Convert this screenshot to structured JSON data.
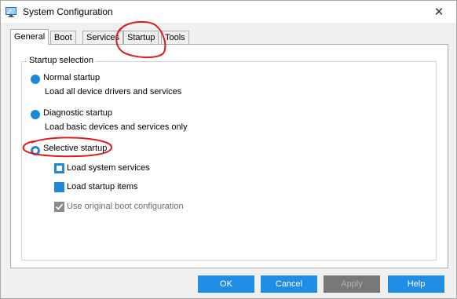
{
  "window": {
    "title": "System Configuration",
    "close_glyph": "✕"
  },
  "tabs": [
    {
      "label": "General",
      "active": true
    },
    {
      "label": "Boot",
      "active": false
    },
    {
      "label": "Services",
      "active": false
    },
    {
      "label": "Startup",
      "active": false
    },
    {
      "label": "Tools",
      "active": false
    }
  ],
  "startup_selection": {
    "legend": "Startup selection",
    "options": [
      {
        "label": "Normal startup",
        "description": "Load all device drivers and services",
        "selected": false
      },
      {
        "label": "Diagnostic startup",
        "description": "Load basic devices and services only",
        "selected": false
      },
      {
        "label": "Selective startup",
        "selected": true
      }
    ],
    "selective_items": [
      {
        "label": "Load system services",
        "checked": false,
        "enabled": true
      },
      {
        "label": "Load startup items",
        "checked": true,
        "enabled": true
      },
      {
        "label": "Use original boot configuration",
        "checked": true,
        "enabled": false
      }
    ]
  },
  "buttons": {
    "ok": "OK",
    "cancel": "Cancel",
    "apply": "Apply",
    "help": "Help"
  },
  "colors": {
    "accent": "#1e88d9",
    "button": "#1f8ee6",
    "annotation": "#e01a1a"
  },
  "icons": [
    "app-icon",
    "close-icon",
    "check-icon"
  ]
}
